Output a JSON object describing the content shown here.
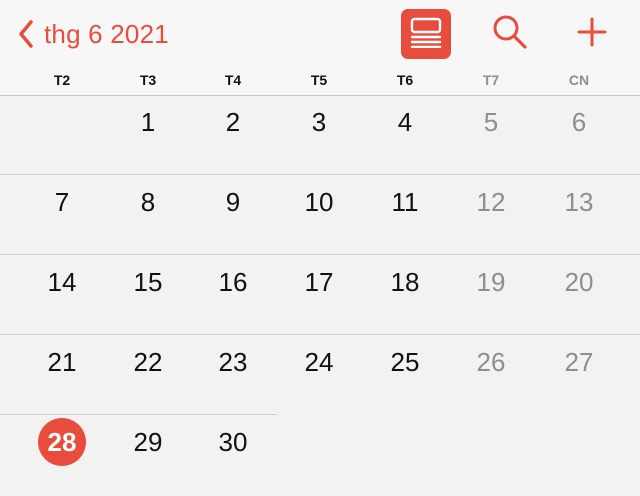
{
  "header": {
    "month_label": "thg 6 2021",
    "icons": {
      "back": "chevron-left-icon",
      "list_view": "list-view-icon",
      "search": "search-icon",
      "add": "plus-icon"
    },
    "accent_color": "#e84c3d"
  },
  "weekdays": [
    {
      "label": "T2",
      "weekend": false
    },
    {
      "label": "T3",
      "weekend": false
    },
    {
      "label": "T4",
      "weekend": false
    },
    {
      "label": "T5",
      "weekend": false
    },
    {
      "label": "T6",
      "weekend": false
    },
    {
      "label": "T7",
      "weekend": true
    },
    {
      "label": "CN",
      "weekend": true
    }
  ],
  "calendar": {
    "first_weekday_index": 1,
    "days_in_month": 30,
    "today": 28
  }
}
